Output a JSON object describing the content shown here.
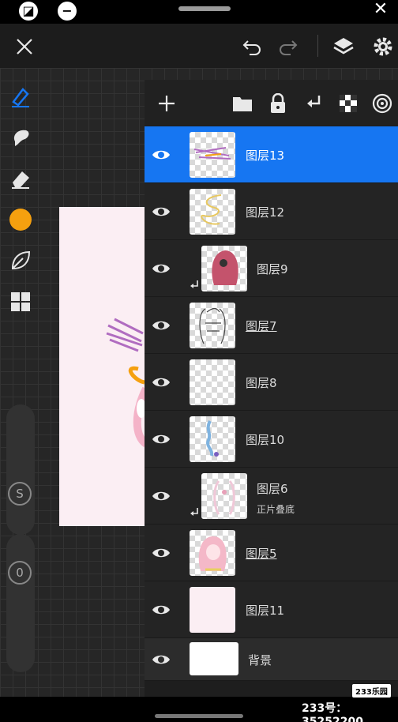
{
  "accent_color": "#1676f2",
  "brush_color": "#f5a00f",
  "top_icons": [
    "close-icon",
    "undo-icon",
    "redo-icon",
    "layers-icon",
    "settings-icon"
  ],
  "left_tools": [
    "pen-icon",
    "smudge-icon",
    "eraser-icon",
    "color-swatch",
    "leaf-icon",
    "grid-icon"
  ],
  "slider_size_label": "S",
  "slider_opacity_label": "0",
  "panel_tools": [
    "add-icon",
    "folder-icon",
    "lock-icon",
    "clip-icon",
    "checker-icon",
    "target-icon"
  ],
  "layers": [
    {
      "name": "图层13",
      "selected": true,
      "clipped": false,
      "underlined": false
    },
    {
      "name": "图层12",
      "selected": false,
      "clipped": false,
      "underlined": false
    },
    {
      "name": "图层9",
      "selected": false,
      "clipped": true,
      "underlined": false
    },
    {
      "name": "图层7",
      "selected": false,
      "clipped": false,
      "underlined": true
    },
    {
      "name": "图层8",
      "selected": false,
      "clipped": false,
      "underlined": false
    },
    {
      "name": "图层10",
      "selected": false,
      "clipped": false,
      "underlined": false
    },
    {
      "name": "图层6",
      "blend_mode": "正片叠底",
      "selected": false,
      "clipped": true,
      "underlined": false
    },
    {
      "name": "图层5",
      "selected": false,
      "clipped": false,
      "underlined": true
    },
    {
      "name": "图层11",
      "selected": false,
      "clipped": false,
      "underlined": false
    }
  ],
  "background_layer": {
    "name": "背景"
  },
  "watermark": {
    "logo": "233乐园",
    "text": "233号：35252200"
  }
}
